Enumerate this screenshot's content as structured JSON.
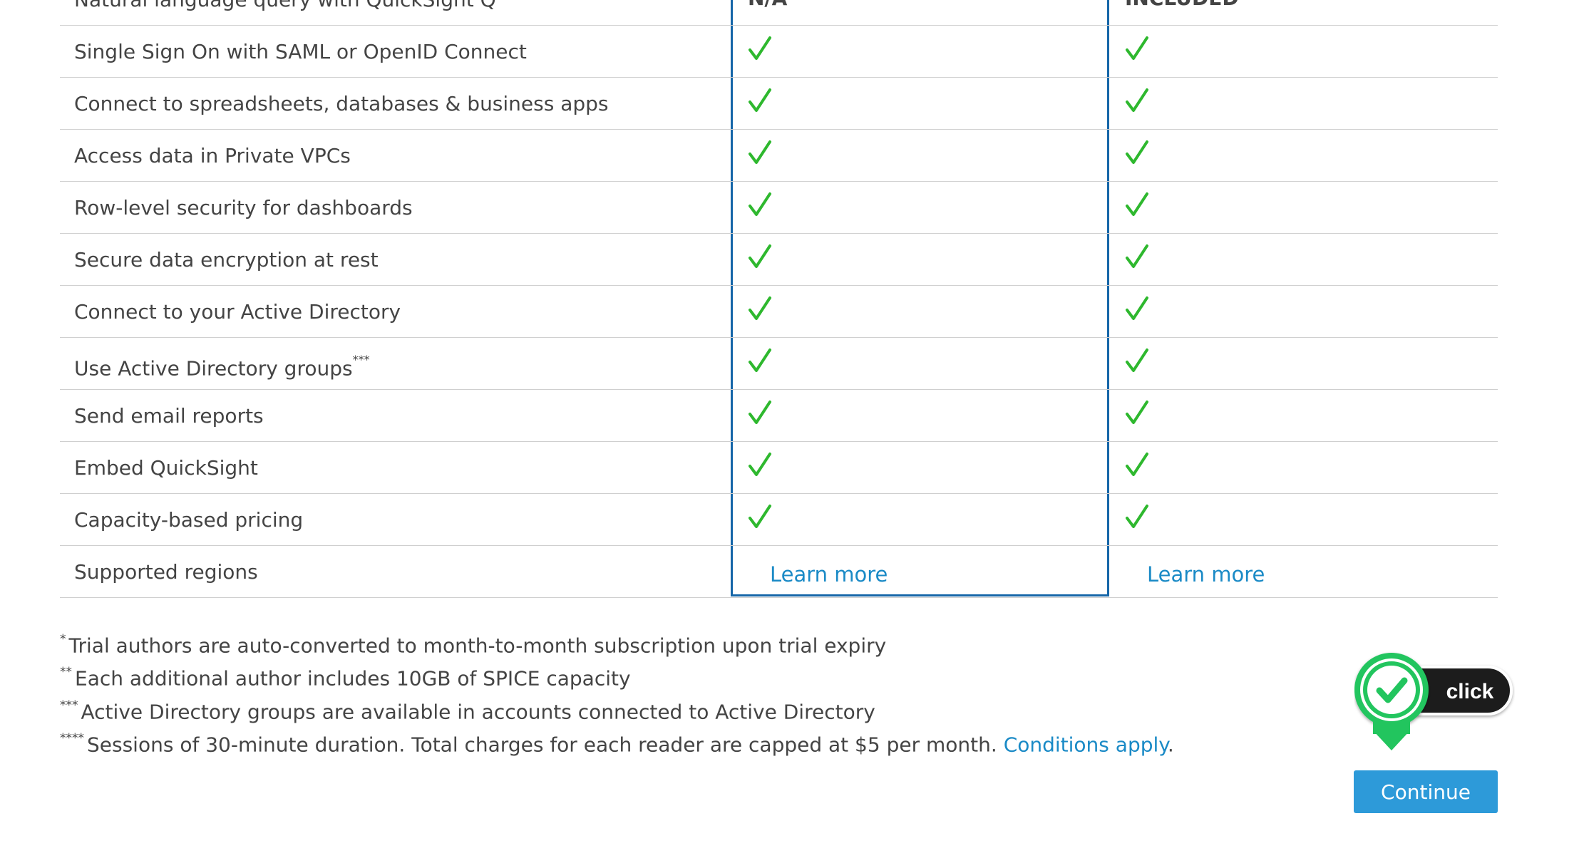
{
  "plans": [
    {
      "header_value": "N/A",
      "learn_more_label": "Learn more"
    },
    {
      "header_value": "INCLUDED",
      "learn_more_label": "Learn more"
    }
  ],
  "features": [
    {
      "label": "Natural language query with QuickSight Q",
      "type": "header"
    },
    {
      "label": "Single Sign On with SAML or OpenID Connect",
      "type": "check"
    },
    {
      "label": "Connect to spreadsheets, databases & business apps",
      "type": "check"
    },
    {
      "label": "Access data in Private VPCs",
      "type": "check"
    },
    {
      "label": "Row-level security for dashboards",
      "type": "check"
    },
    {
      "label": "Secure data encryption at rest",
      "type": "check"
    },
    {
      "label": "Connect to your Active Directory",
      "type": "check"
    },
    {
      "label": "Use Active Directory groups",
      "sup": "***",
      "type": "check"
    },
    {
      "label": "Send email reports",
      "type": "check"
    },
    {
      "label": "Embed QuickSight",
      "type": "check"
    },
    {
      "label": "Capacity-based pricing",
      "type": "check"
    },
    {
      "label": "Supported regions",
      "type": "link"
    }
  ],
  "footnotes": [
    {
      "marker": "*",
      "text": "Trial authors are auto-converted to month-to-month subscription upon trial expiry"
    },
    {
      "marker": "**",
      "text": "Each additional author includes 10GB of SPICE capacity"
    },
    {
      "marker": "***",
      "text": "Active Directory groups are available in accounts connected to Active Directory"
    },
    {
      "marker": "****",
      "text": "Sessions of 30-minute duration. Total charges for each reader are capped at $5 per month.",
      "link": "Conditions apply",
      "after": "."
    }
  ],
  "continue_label": "Continue",
  "click_badge_label": "click",
  "colors": {
    "check": "#2eb82e",
    "link": "#1a8ac6",
    "plan_border": "#1666a8",
    "button": "#2d9ad9",
    "badge_green": "#22c55e"
  },
  "icons": {
    "check": "check-icon",
    "badge": "click-badge-check-icon"
  }
}
